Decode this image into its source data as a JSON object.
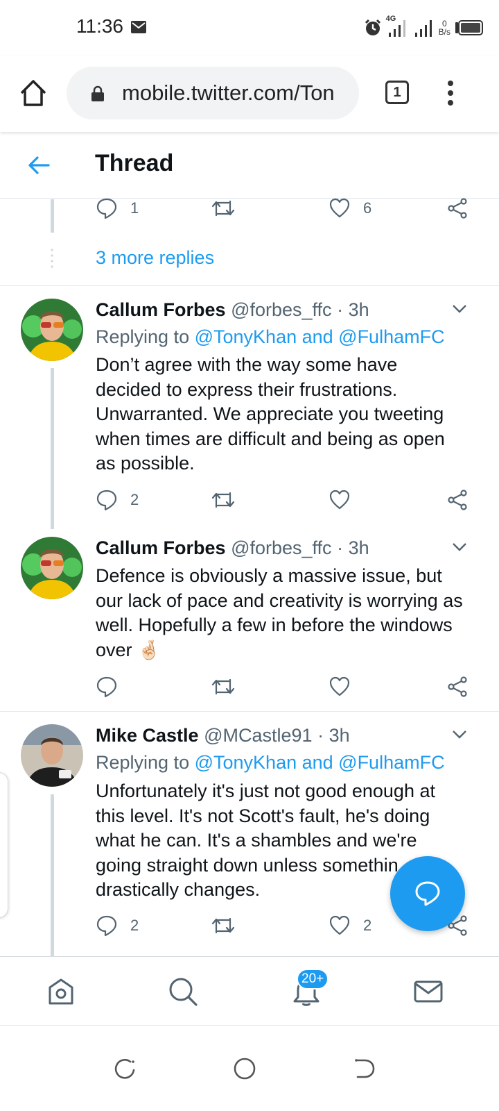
{
  "status_bar": {
    "time": "11:36",
    "network": "4G",
    "speed_value": "0",
    "speed_unit": "B/s"
  },
  "browser": {
    "url": "mobile.twitter.com/Ton",
    "tab_count": "1"
  },
  "header": {
    "title": "Thread"
  },
  "prev_tweet_actions": {
    "replies": "1",
    "likes": "6"
  },
  "more_replies": "3 more replies",
  "tweets": [
    {
      "name": "Callum Forbes",
      "handle": "@forbes_ffc",
      "sep": "·",
      "time": "3h",
      "replying_prefix": "Replying to",
      "replying_to": "@TonyKhan and @FulhamFC",
      "text": "Don’t agree with the way some have decided to express their frustrations. Unwarranted. We appreciate you tweeting when times are difficult and being as open as possible.",
      "replies": "2",
      "retweets": "",
      "likes": ""
    },
    {
      "name": "Callum Forbes",
      "handle": "@forbes_ffc",
      "sep": "·",
      "time": "3h",
      "text": "Defence is obviously a massive issue, but our lack of pace and creativity is worrying as well. Hopefully a few in before the windows over",
      "emoji": "🤞🏻",
      "replies": "",
      "retweets": "",
      "likes": ""
    },
    {
      "name": "Mike Castle",
      "handle": "@MCastle91",
      "sep": "·",
      "time": "3h",
      "replying_prefix": "Replying to",
      "replying_to": "@TonyKhan and @FulhamFC",
      "text": "Unfortunately it's just not good enough at this level. It's not Scott's fault, he's doing what he can. It's a shambles and we're going straight down unless somethin drastically changes.",
      "replies": "2",
      "retweets": "",
      "likes": "2"
    }
  ],
  "bottom_nav": {
    "notifications_badge": "20+"
  },
  "colors": {
    "accent": "#1d9bf0",
    "text": "#0f1419",
    "muted": "#536471",
    "thread_line": "#cfd9de"
  }
}
